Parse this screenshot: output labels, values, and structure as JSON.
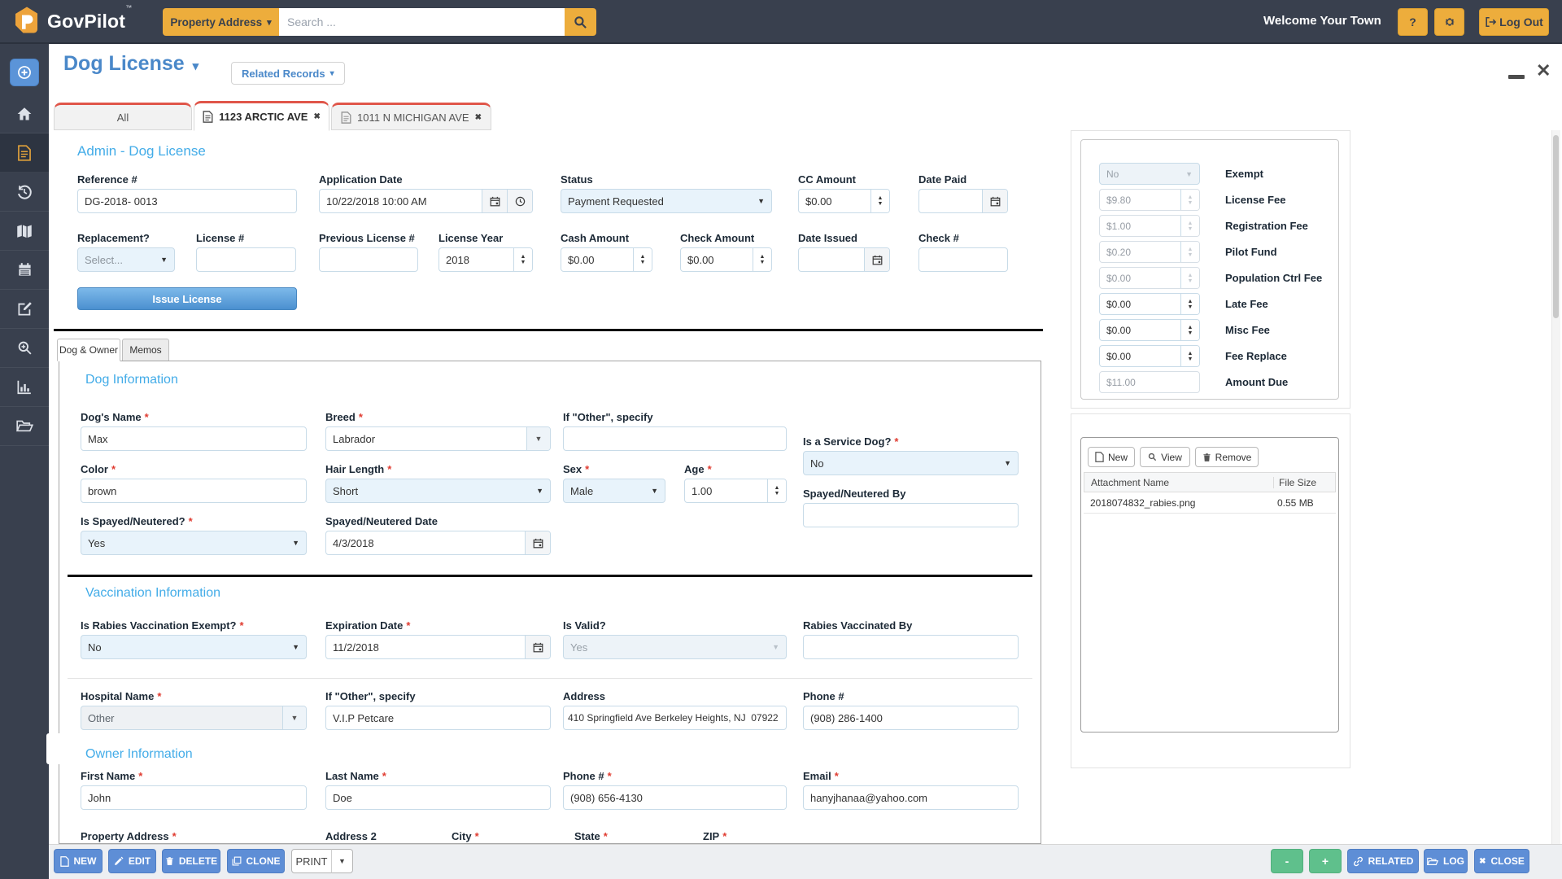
{
  "icons": {
    "caret_down": "▾",
    "select_caret": "▼",
    "spin_up": "▲",
    "spin_down": "▼",
    "close_x": "✖",
    "window_close": "✕"
  },
  "navbar": {
    "brand": "GovPilot",
    "trademark": "™",
    "category_button": "Property Address",
    "search_placeholder": "Search ...",
    "welcome_text": "Welcome Your Town",
    "help_button": "?",
    "logout_button": "Log Out"
  },
  "sidebar": {
    "icons": [
      "add-record",
      "home",
      "documents",
      "history",
      "map",
      "calendar",
      "edit",
      "search-zoom",
      "reports",
      "files"
    ]
  },
  "header": {
    "title": "Dog License",
    "related_records_button": "Related Records"
  },
  "record_tabs": [
    {
      "label": "All"
    },
    {
      "label": "1123 ARCTIC AVE"
    },
    {
      "label": "1011 N MICHIGAN AVE"
    }
  ],
  "admin": {
    "section_title": "Admin - Dog License",
    "reference": {
      "label": "Reference #",
      "value": "DG-2018- 0013"
    },
    "application_date": {
      "label": "Application Date",
      "value": "10/22/2018 10:00 AM"
    },
    "status": {
      "label": "Status",
      "value": "Payment Requested"
    },
    "cc_amount": {
      "label": "CC Amount",
      "value": "$0.00"
    },
    "date_paid": {
      "label": "Date Paid",
      "value": ""
    },
    "replacement": {
      "label": "Replacement?",
      "value": "Select..."
    },
    "license_number": {
      "label": "License #",
      "value": ""
    },
    "previous_license": {
      "label": "Previous License #",
      "value": ""
    },
    "license_year": {
      "label": "License Year",
      "value": "2018"
    },
    "cash_amount": {
      "label": "Cash Amount",
      "value": "$0.00"
    },
    "check_amount": {
      "label": "Check Amount",
      "value": "$0.00"
    },
    "date_issued": {
      "label": "Date Issued",
      "value": ""
    },
    "check_number": {
      "label": "Check #",
      "value": ""
    },
    "issue_button": "Issue License"
  },
  "detail_tabs": [
    {
      "label": "Dog & Owner"
    },
    {
      "label": "Memos"
    }
  ],
  "dog": {
    "section_title": "Dog Information",
    "dogs_name": {
      "label": "Dog's Name",
      "value": "Max"
    },
    "breed": {
      "label": "Breed",
      "value": "Labrador"
    },
    "breed_other": {
      "label": "If \"Other\", specify",
      "value": ""
    },
    "service_dog": {
      "label": "Is a Service Dog?",
      "value": "No"
    },
    "color": {
      "label": "Color",
      "value": "brown"
    },
    "hair_length": {
      "label": "Hair Length",
      "value": "Short"
    },
    "sex": {
      "label": "Sex",
      "value": "Male"
    },
    "age": {
      "label": "Age",
      "value": "1.00"
    },
    "spayed_by": {
      "label": "Spayed/Neutered By",
      "value": ""
    },
    "is_spayed": {
      "label": "Is Spayed/Neutered?",
      "value": "Yes"
    },
    "spayed_date": {
      "label": "Spayed/Neutered Date",
      "value": "4/3/2018"
    }
  },
  "vaccination": {
    "section_title": "Vaccination Information",
    "rabies_exempt": {
      "label": "Is Rabies Vaccination Exempt?",
      "value": "No"
    },
    "expiration_date": {
      "label": "Expiration Date",
      "value": "11/2/2018"
    },
    "is_valid": {
      "label": "Is Valid?",
      "value": "Yes"
    },
    "vaccinated_by": {
      "label": "Rabies Vaccinated By",
      "value": ""
    },
    "hospital_name": {
      "label": "Hospital Name",
      "value": "Other"
    },
    "hospital_other": {
      "label": "If \"Other\", specify",
      "value": "V.I.P Petcare"
    },
    "address": {
      "label": "Address",
      "value": "410 Springfield Ave Berkeley Heights, NJ  07922"
    },
    "phone": {
      "label": "Phone #",
      "value": "(908) 286-1400"
    }
  },
  "owner": {
    "section_title": "Owner Information",
    "first_name": {
      "label": "First Name",
      "value": "John"
    },
    "last_name": {
      "label": "Last Name",
      "value": "Doe"
    },
    "phone": {
      "label": "Phone #",
      "value": "(908) 656-4130"
    },
    "email": {
      "label": "Email",
      "value": "hanyjhanaa@yahoo.com"
    },
    "property_address_label": "Property Address",
    "address2_label": "Address 2",
    "city_label": "City",
    "state_label": "State",
    "zip_label": "ZIP"
  },
  "fees": {
    "rows": [
      {
        "value": "No",
        "label": "Exempt",
        "control": "select",
        "state": "disabled"
      },
      {
        "value": "$9.80",
        "label": "License Fee",
        "control": "spinner",
        "state": "disabled"
      },
      {
        "value": "$1.00",
        "label": "Registration Fee",
        "control": "spinner",
        "state": "disabled"
      },
      {
        "value": "$0.20",
        "label": "Pilot Fund",
        "control": "spinner",
        "state": "disabled"
      },
      {
        "value": "$0.00",
        "label": "Population Ctrl Fee",
        "control": "spinner",
        "state": "disabled"
      },
      {
        "value": "$0.00",
        "label": "Late Fee",
        "control": "spinner",
        "state": "enabled"
      },
      {
        "value": "$0.00",
        "label": "Misc Fee",
        "control": "spinner",
        "state": "enabled"
      },
      {
        "value": "$0.00",
        "label": "Fee Replace",
        "control": "spinner",
        "state": "enabled"
      },
      {
        "value": "$11.00",
        "label": "Amount Due",
        "control": "text",
        "state": "readonly"
      }
    ]
  },
  "attachments": {
    "new_button": "New",
    "view_button": "View",
    "remove_button": "Remove",
    "columns": [
      "Attachment Name",
      "File Size"
    ],
    "rows": [
      {
        "name": "2018074832_rabies.png",
        "size": "0.55 MB"
      }
    ]
  },
  "footer": {
    "new": "NEW",
    "edit": "EDIT",
    "delete": "DELETE",
    "clone": "CLONE",
    "print": "PRINT",
    "minus": "-",
    "plus": "+",
    "related": "RELATED",
    "log": "LOG",
    "close": "CLOSE"
  },
  "misc": {
    "required_marker": "*"
  },
  "colors": {
    "navy": "#39404E",
    "orange": "#EDAD3C",
    "title_blue": "#4A88C9",
    "section_blue": "#43ACE8",
    "tab_red": "#E0564A",
    "button_blue": "#5E8ED6",
    "button_green": "#5FC08C"
  }
}
